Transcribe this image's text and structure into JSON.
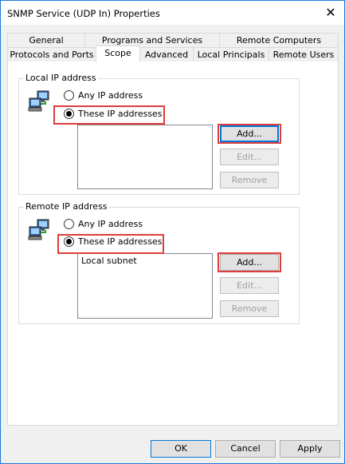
{
  "window": {
    "title": "SNMP Service (UDP In) Properties",
    "close_glyph": "✕"
  },
  "tabs_row1": [
    "General",
    "Programs and Services",
    "Remote Computers"
  ],
  "tabs_row2": [
    "Protocols and Ports",
    "Scope",
    "Advanced",
    "Local Principals",
    "Remote Users"
  ],
  "active_tab": "Scope",
  "local": {
    "group_label": "Local IP address",
    "option_any": "Any IP address",
    "option_these": "These IP addresses:",
    "selected": "these",
    "list_items": [],
    "add_label": "Add...",
    "edit_label": "Edit...",
    "remove_label": "Remove"
  },
  "remote": {
    "group_label": "Remote IP address",
    "option_any": "Any IP address",
    "option_these": "These IP addresses:",
    "selected": "these",
    "list_items": [
      "Local subnet"
    ],
    "add_label": "Add...",
    "edit_label": "Edit...",
    "remove_label": "Remove"
  },
  "footer": {
    "ok_label": "OK",
    "cancel_label": "Cancel",
    "apply_label": "Apply"
  },
  "colors": {
    "highlight": "#e03c3c",
    "focus": "#0078d7"
  }
}
